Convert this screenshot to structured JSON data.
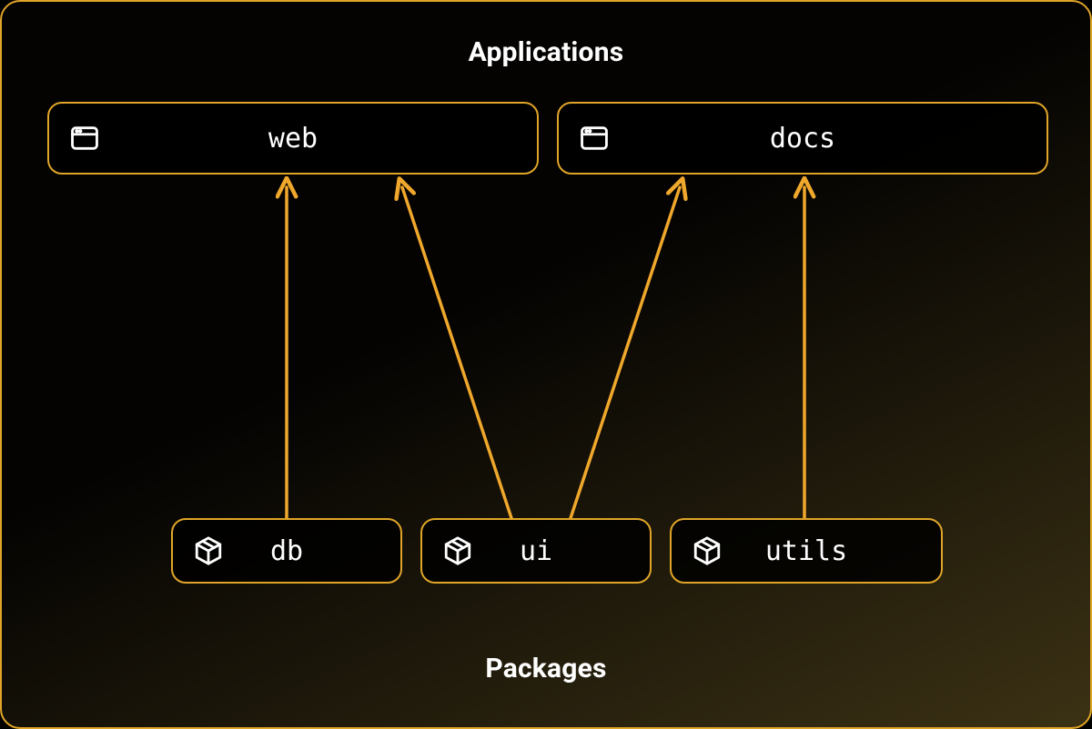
{
  "sections": {
    "top_title": "Applications",
    "bottom_title": "Packages"
  },
  "applications": [
    {
      "id": "web",
      "label": "web",
      "icon": "app-window-icon"
    },
    {
      "id": "docs",
      "label": "docs",
      "icon": "app-window-icon"
    }
  ],
  "packages": [
    {
      "id": "db",
      "label": "db",
      "icon": "package-box-icon"
    },
    {
      "id": "ui",
      "label": "ui",
      "icon": "package-box-icon"
    },
    {
      "id": "utils",
      "label": "utils",
      "icon": "package-box-icon"
    }
  ],
  "edges": [
    {
      "from": "db",
      "to": "web"
    },
    {
      "from": "ui",
      "to": "web"
    },
    {
      "from": "ui",
      "to": "docs"
    },
    {
      "from": "utils",
      "to": "docs"
    }
  ],
  "colors": {
    "accent": "#e0a528",
    "arrow": "#f0a82c",
    "text": "#ffffff",
    "bg_top": "#040302",
    "bg_bottom": "#3b3114"
  }
}
